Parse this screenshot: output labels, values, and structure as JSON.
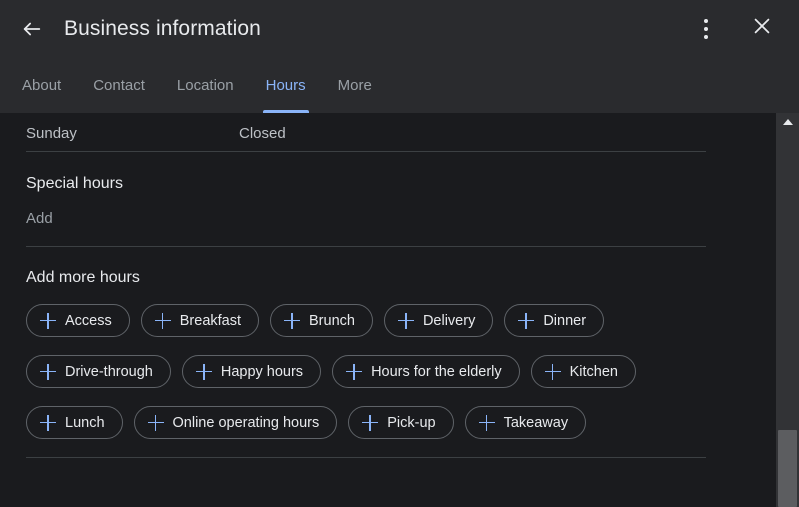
{
  "header": {
    "title": "Business information",
    "back_icon": "arrow-back-icon",
    "menu_icon": "more-vert-icon",
    "close_icon": "close-icon"
  },
  "tabs": [
    {
      "label": "About",
      "active": false
    },
    {
      "label": "Contact",
      "active": false
    },
    {
      "label": "Location",
      "active": false
    },
    {
      "label": "Hours",
      "active": true
    },
    {
      "label": "More",
      "active": false
    }
  ],
  "content": {
    "hours_row": {
      "day": "Sunday",
      "value": "Closed"
    },
    "special_hours": {
      "title": "Special hours",
      "add_label": "Add"
    },
    "add_more_hours": {
      "title": "Add more hours",
      "rows": [
        [
          "Access",
          "Breakfast",
          "Brunch",
          "Delivery",
          "Dinner"
        ],
        [
          "Drive-through",
          "Happy hours",
          "Hours for the elderly",
          "Kitchen"
        ],
        [
          "Lunch",
          "Online operating hours",
          "Pick-up",
          "Takeaway"
        ]
      ]
    }
  },
  "scrollbar": {
    "up_arrow_icon": "scroll-up-arrow-icon"
  },
  "colors": {
    "accent": "#8ab4f8",
    "header_bg": "#2a2b2e",
    "content_bg": "#1a1b1e",
    "text_primary": "#e8eaed",
    "text_secondary": "#9aa0a6",
    "divider": "#3c4043",
    "chip_border": "#5f6368"
  }
}
